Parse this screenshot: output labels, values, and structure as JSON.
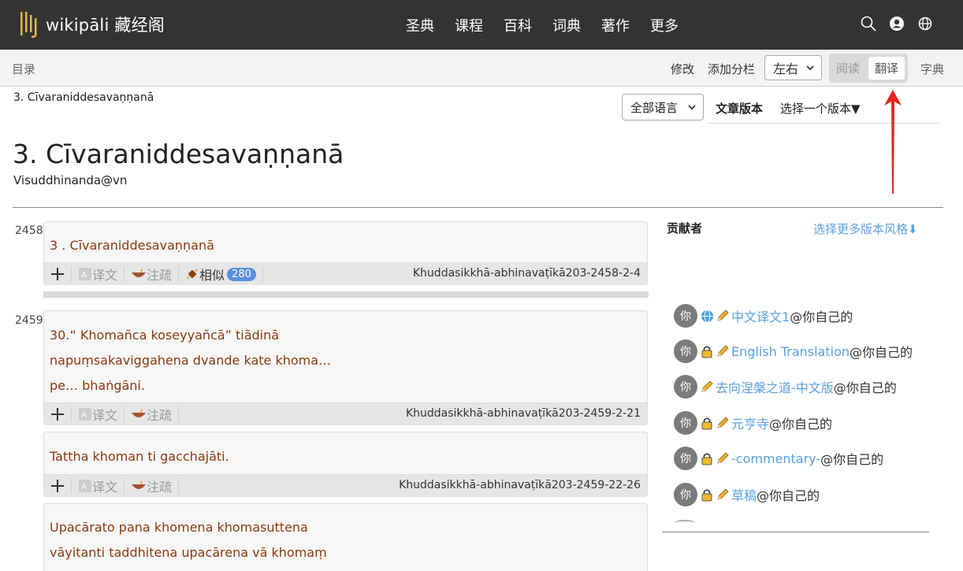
{
  "brand": {
    "name": "wikipāli",
    "suffix": "藏经阁"
  },
  "nav": [
    "圣典",
    "课程",
    "百科",
    "词典",
    "著作",
    "更多"
  ],
  "toolbar": {
    "toc": "目录",
    "edit": "修改",
    "add_column": "添加分栏",
    "layout_value": "左右",
    "read": "阅读",
    "translate": "翻译",
    "dictionary": "字典"
  },
  "header": {
    "breadcrumb": "3. Cīvaraniddesavaṇṇanā",
    "language_select": "全部语言",
    "version_label": "文章版本",
    "version_choose": "选择一个版本▼",
    "title": "3. Cīvaraniddesavaṇṇanā",
    "author": "Visuddhinanda@vn"
  },
  "sentence_bar": {
    "translation": "译文",
    "commentary": "注疏",
    "similar": "相似"
  },
  "sentences": [
    {
      "para": "2458",
      "lines": [
        "3 . Cīvaraniddesavaṇṇanā"
      ],
      "id": "Khuddasikkhā-abhinavaṭīkā203-2458-2-4",
      "similar_count": "280"
    },
    {
      "para": "2459",
      "lines": [
        "30.“ Khomañca koseyyañcā” tiādinā",
        "napuṃsakaviggahena dvande kate khoma…",
        "pe… bhaṅgāni."
      ],
      "id": "Khuddasikkhā-abhinavaṭīkā203-2459-2-21"
    },
    {
      "para": "",
      "lines": [
        "Tattha khoman ti gacchajāti."
      ],
      "id": "Khuddasikkhā-abhinavaṭīkā203-2459-22-26"
    },
    {
      "para": "",
      "lines": [
        "Upacārato pana khomena khomasuttena",
        "vāyitanti taddhitena upacārena vā khomaṃ"
      ],
      "id": ""
    }
  ],
  "contributors": {
    "title": "贡献者",
    "more_style": "选择更多版本风格⬇",
    "avatar_label": "你",
    "items": [
      {
        "name": "中文译文1",
        "owner": "@你自己的",
        "icons": [
          "globe-icon",
          "pencil-icon"
        ]
      },
      {
        "name": "English Translation",
        "owner": "@你自己的",
        "icons": [
          "lock-icon",
          "pencil-icon"
        ]
      },
      {
        "name": "去向涅槃之道-中文版",
        "owner": "@你自己的",
        "icons": [
          "pencil-icon"
        ]
      },
      {
        "name": "元亨寺",
        "owner": "@你自己的",
        "icons": [
          "lock-icon",
          "pencil-icon"
        ]
      },
      {
        "name": "-commentary-",
        "owner": "@你自己的",
        "icons": [
          "lock-icon",
          "pencil-icon"
        ]
      },
      {
        "name": "草稿",
        "owner": "@你自己的",
        "icons": [
          "lock-icon",
          "pencil-icon"
        ]
      }
    ]
  },
  "colors": {
    "topbar": "#333333",
    "link": "#5aa0e0",
    "pali_text": "#8b3a0e",
    "annotation_arrow": "#e8231f"
  }
}
